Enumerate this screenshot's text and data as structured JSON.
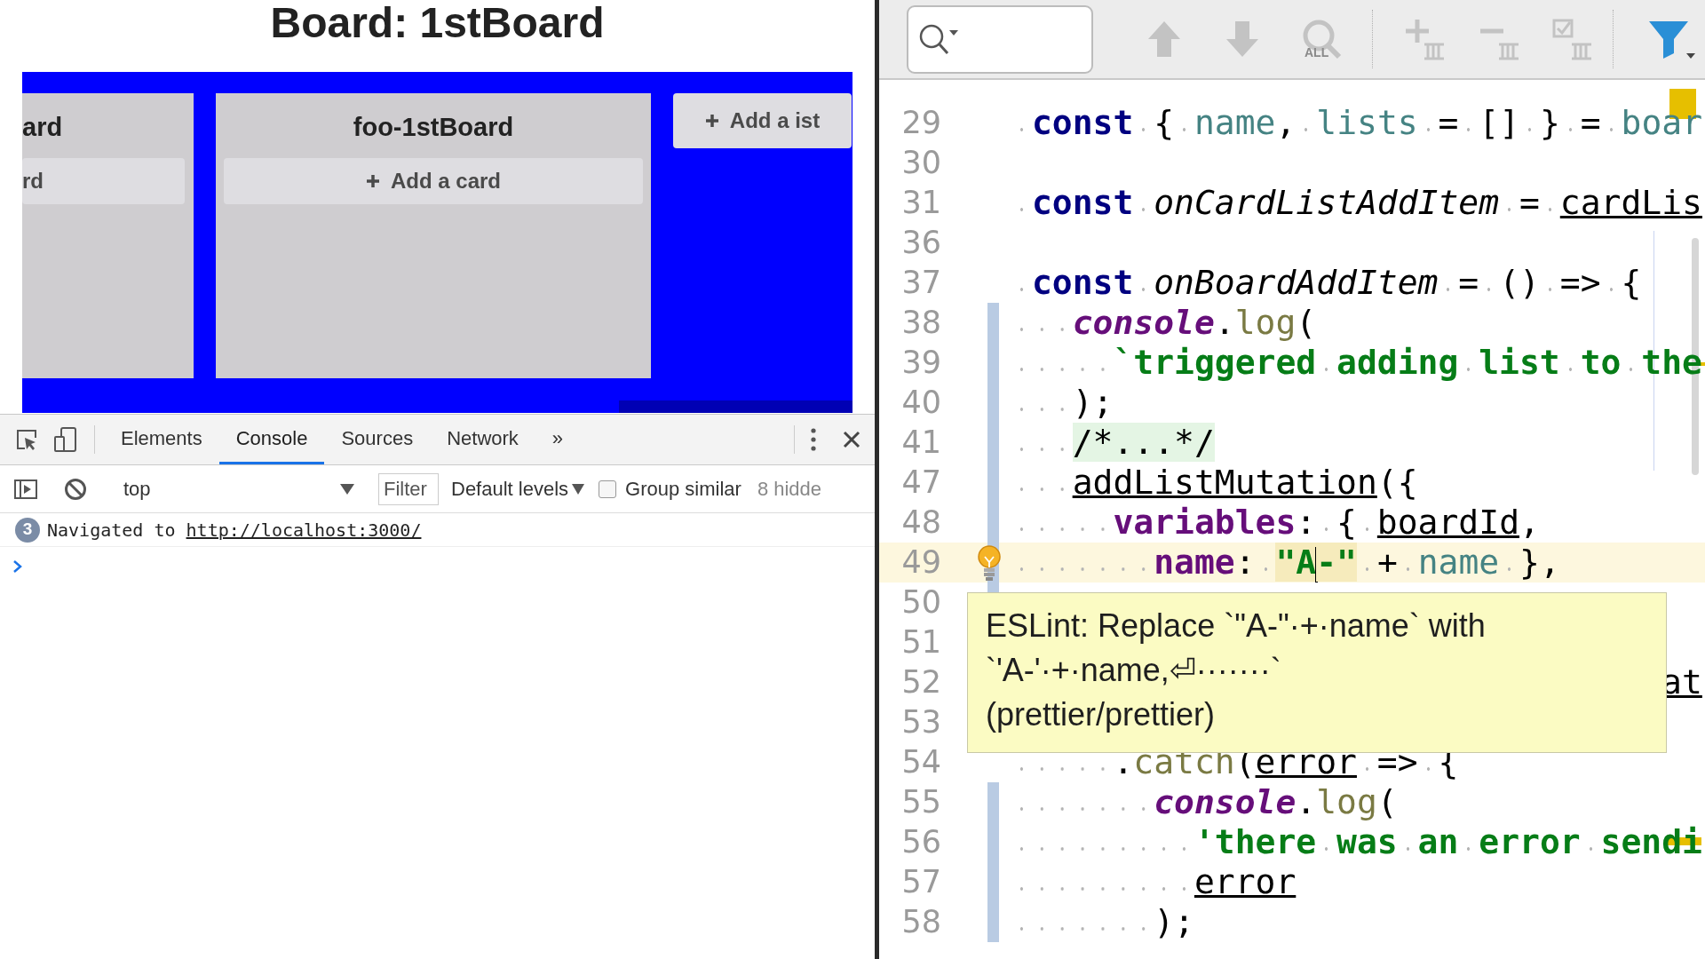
{
  "board": {
    "title": "Board: 1stBoard",
    "lists": [
      {
        "title": "ard",
        "add_card": "rd",
        "cut": true
      },
      {
        "title": "foo-1stBoard",
        "add_card": "Add a card",
        "cut": false
      }
    ],
    "add_list": "Add a ist"
  },
  "devtools": {
    "tabs": [
      {
        "label": "Elements",
        "selected": false
      },
      {
        "label": "Console",
        "selected": true
      },
      {
        "label": "Sources",
        "selected": false
      },
      {
        "label": "Network",
        "selected": false
      }
    ],
    "more": "»",
    "context": "top",
    "filter": {
      "placeholder": "Filter"
    },
    "levels": "Default levels",
    "group_similar": {
      "label": "Group similar",
      "checked": false
    },
    "hidden": "8 hidde",
    "messages": [
      {
        "count": "3",
        "text": "Navigated to",
        "link": "http://localhost:3000/"
      }
    ]
  },
  "editor": {
    "find_all": "ALL",
    "lines": [
      {
        "number": "29",
        "changed": false,
        "current": false,
        "tokens": [
          {
            "text": " const",
            "kind": "keyword"
          },
          {
            "text": " { ",
            "kind": "plain"
          },
          {
            "text": "name",
            "kind": "variable"
          },
          {
            "text": ", ",
            "kind": "plain"
          },
          {
            "text": "lists",
            "kind": "variable"
          },
          {
            "text": " = [] } = ",
            "kind": "plain"
          },
          {
            "text": "boar",
            "kind": "variable"
          }
        ]
      },
      {
        "number": "30",
        "changed": false,
        "current": false
      },
      {
        "number": "31",
        "changed": false,
        "current": false,
        "tokens": [
          {
            "text": " const",
            "kind": "keyword"
          },
          {
            "text": " onCardListAddItem",
            "kind": "function"
          },
          {
            "text": " = ",
            "kind": "plain"
          },
          {
            "text": "cardLis",
            "kind": "reference"
          }
        ]
      },
      {
        "number": "36",
        "changed": false,
        "current": false
      },
      {
        "number": "37",
        "changed": false,
        "current": false,
        "tokens": [
          {
            "text": " const",
            "kind": "keyword"
          },
          {
            "text": " onBoardAddItem",
            "kind": "function"
          },
          {
            "text": " = () => {",
            "kind": "plain"
          }
        ]
      },
      {
        "number": "38",
        "changed": true,
        "current": false,
        "tokens": [
          {
            "text": "   console",
            "kind": "object"
          },
          {
            "text": ".",
            "kind": "plain"
          },
          {
            "text": "log",
            "kind": "method"
          },
          {
            "text": "(",
            "kind": "plain"
          }
        ]
      },
      {
        "number": "39",
        "changed": true,
        "current": false,
        "tokens": [
          {
            "text": "     `triggered adding list to the",
            "kind": "string"
          }
        ]
      },
      {
        "number": "40",
        "changed": true,
        "current": false,
        "tokens": [
          {
            "text": "   );",
            "kind": "plain"
          }
        ]
      },
      {
        "number": "41",
        "changed": true,
        "current": false,
        "tokens": [
          {
            "text": "   /*...*/",
            "kind": "folded"
          }
        ]
      },
      {
        "number": "47",
        "changed": true,
        "current": false,
        "tokens": [
          {
            "text": "   addListMutation",
            "kind": "reference"
          },
          {
            "text": "({",
            "kind": "plain"
          }
        ]
      },
      {
        "number": "48",
        "changed": true,
        "current": false,
        "tokens": [
          {
            "text": "     variables",
            "kind": "property"
          },
          {
            "text": ": { ",
            "kind": "plain"
          },
          {
            "text": "boardId",
            "kind": "reference"
          },
          {
            "text": ",",
            "kind": "plain"
          }
        ]
      },
      {
        "number": "49",
        "changed": true,
        "current": true,
        "bulb": true,
        "tokens": [
          {
            "text": "       name",
            "kind": "property"
          },
          {
            "text": ": ",
            "kind": "plain"
          },
          {
            "text": "\"A",
            "kind": "string",
            "warning": true,
            "caret_after": true
          },
          {
            "text": "-\"",
            "kind": "string",
            "warning": true
          },
          {
            "text": " + ",
            "kind": "plain"
          },
          {
            "text": "name",
            "kind": "variable"
          },
          {
            "text": " },",
            "kind": "plain"
          }
        ]
      },
      {
        "number": "50",
        "changed": true,
        "current": false
      },
      {
        "number": "51",
        "current": false
      },
      {
        "number": "52",
        "current": false,
        "tokens": [
          {
            "text": "                                at",
            "kind": "reference"
          }
        ]
      },
      {
        "number": "53",
        "current": false
      },
      {
        "number": "54",
        "changed": false,
        "current": false,
        "tokens": [
          {
            "text": "     .",
            "kind": "plain"
          },
          {
            "text": "catch",
            "kind": "method"
          },
          {
            "text": "(",
            "kind": "plain"
          },
          {
            "text": "error",
            "kind": "reference"
          },
          {
            "text": " => {",
            "kind": "plain"
          }
        ]
      },
      {
        "number": "55",
        "changed": true,
        "current": false,
        "tokens": [
          {
            "text": "       console",
            "kind": "object"
          },
          {
            "text": ".",
            "kind": "plain"
          },
          {
            "text": "log",
            "kind": "method"
          },
          {
            "text": "(",
            "kind": "plain"
          }
        ]
      },
      {
        "number": "56",
        "changed": true,
        "current": false,
        "tokens": [
          {
            "text": "         'there was an error sendi",
            "kind": "string"
          }
        ]
      },
      {
        "number": "57",
        "changed": true,
        "current": false,
        "tokens": [
          {
            "text": "         error",
            "kind": "reference"
          }
        ]
      },
      {
        "number": "58",
        "changed": true,
        "current": false,
        "tokens": [
          {
            "text": "       );",
            "kind": "plain"
          }
        ]
      }
    ],
    "tooltip": "ESLint: Replace `\"A-\"·+·name` with\n`'A-'·+·name,⏎·······`\n(prettier/prettier)"
  }
}
